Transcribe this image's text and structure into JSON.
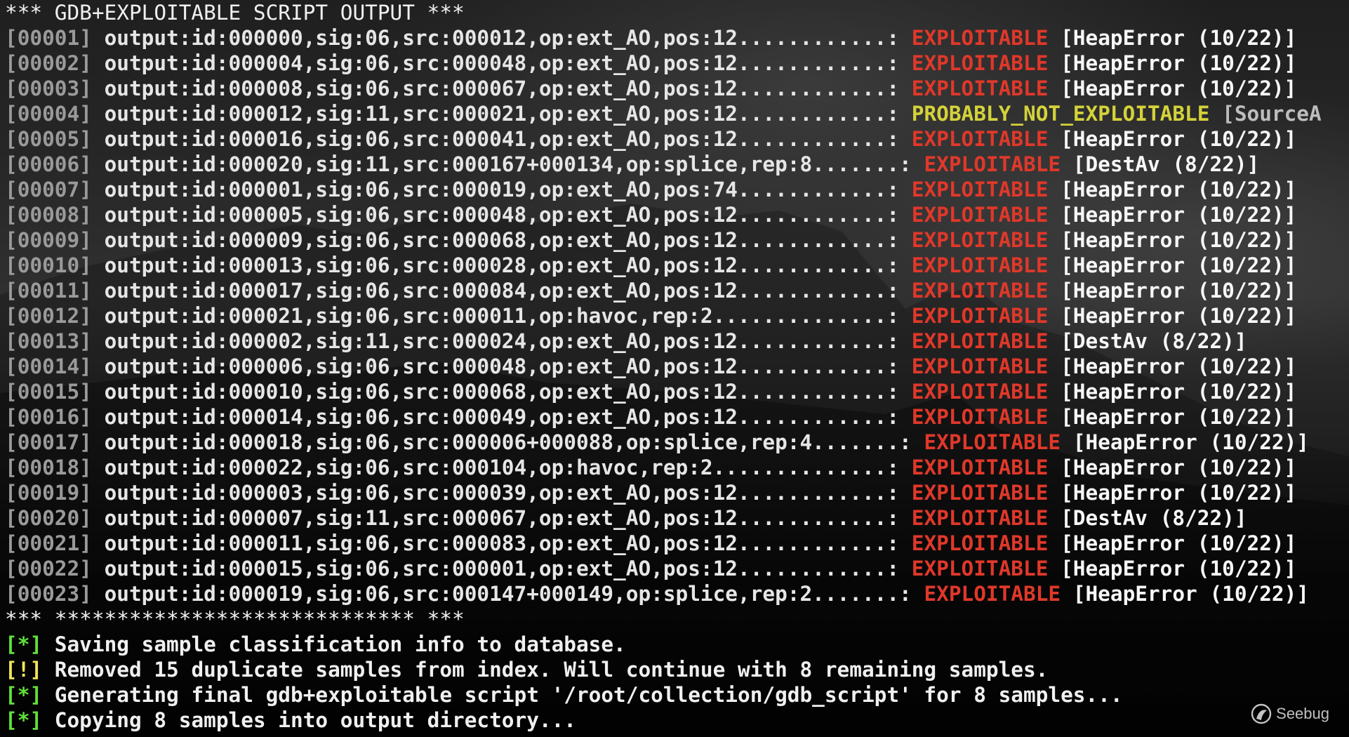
{
  "header": "*** GDB+EXPLOITABLE SCRIPT OUTPUT ***",
  "rows": [
    {
      "idx": "[00001]",
      "path": "output:id:000000,sig:06,src:000012,op:ext_AO,pos:12............:",
      "cls": "EXPLOITABLE",
      "tag": "[HeapError (10/22)]",
      "color": "red"
    },
    {
      "idx": "[00002]",
      "path": "output:id:000004,sig:06,src:000048,op:ext_AO,pos:12............:",
      "cls": "EXPLOITABLE",
      "tag": "[HeapError (10/22)]",
      "color": "red"
    },
    {
      "idx": "[00003]",
      "path": "output:id:000008,sig:06,src:000067,op:ext_AO,pos:12............:",
      "cls": "EXPLOITABLE",
      "tag": "[HeapError (10/22)]",
      "color": "red"
    },
    {
      "idx": "[00004]",
      "path": "output:id:000012,sig:11,src:000021,op:ext_AO,pos:12............:",
      "cls": "PROBABLY_NOT_EXPLOITABLE",
      "tag": "[SourceA",
      "color": "yellow"
    },
    {
      "idx": "[00005]",
      "path": "output:id:000016,sig:06,src:000041,op:ext_AO,pos:12............:",
      "cls": "EXPLOITABLE",
      "tag": "[HeapError (10/22)]",
      "color": "red"
    },
    {
      "idx": "[00006]",
      "path": "output:id:000020,sig:11,src:000167+000134,op:splice,rep:8.......:",
      "cls": "EXPLOITABLE",
      "tag": "[DestAv (8/22)]",
      "color": "red"
    },
    {
      "idx": "[00007]",
      "path": "output:id:000001,sig:06,src:000019,op:ext_AO,pos:74............:",
      "cls": "EXPLOITABLE",
      "tag": "[HeapError (10/22)]",
      "color": "red"
    },
    {
      "idx": "[00008]",
      "path": "output:id:000005,sig:06,src:000048,op:ext_AO,pos:12............:",
      "cls": "EXPLOITABLE",
      "tag": "[HeapError (10/22)]",
      "color": "red"
    },
    {
      "idx": "[00009]",
      "path": "output:id:000009,sig:06,src:000068,op:ext_AO,pos:12............:",
      "cls": "EXPLOITABLE",
      "tag": "[HeapError (10/22)]",
      "color": "red"
    },
    {
      "idx": "[00010]",
      "path": "output:id:000013,sig:06,src:000028,op:ext_AO,pos:12............:",
      "cls": "EXPLOITABLE",
      "tag": "[HeapError (10/22)]",
      "color": "red"
    },
    {
      "idx": "[00011]",
      "path": "output:id:000017,sig:06,src:000084,op:ext_AO,pos:12............:",
      "cls": "EXPLOITABLE",
      "tag": "[HeapError (10/22)]",
      "color": "red"
    },
    {
      "idx": "[00012]",
      "path": "output:id:000021,sig:06,src:000011,op:havoc,rep:2..............:",
      "cls": "EXPLOITABLE",
      "tag": "[HeapError (10/22)]",
      "color": "red"
    },
    {
      "idx": "[00013]",
      "path": "output:id:000002,sig:11,src:000024,op:ext_AO,pos:12............:",
      "cls": "EXPLOITABLE",
      "tag": "[DestAv (8/22)]",
      "color": "red"
    },
    {
      "idx": "[00014]",
      "path": "output:id:000006,sig:06,src:000048,op:ext_AO,pos:12............:",
      "cls": "EXPLOITABLE",
      "tag": "[HeapError (10/22)]",
      "color": "red"
    },
    {
      "idx": "[00015]",
      "path": "output:id:000010,sig:06,src:000068,op:ext_AO,pos:12............:",
      "cls": "EXPLOITABLE",
      "tag": "[HeapError (10/22)]",
      "color": "red"
    },
    {
      "idx": "[00016]",
      "path": "output:id:000014,sig:06,src:000049,op:ext_AO,pos:12............:",
      "cls": "EXPLOITABLE",
      "tag": "[HeapError (10/22)]",
      "color": "red"
    },
    {
      "idx": "[00017]",
      "path": "output:id:000018,sig:06,src:000006+000088,op:splice,rep:4.......:",
      "cls": "EXPLOITABLE",
      "tag": "[HeapError (10/22)]",
      "color": "red"
    },
    {
      "idx": "[00018]",
      "path": "output:id:000022,sig:06,src:000104,op:havoc,rep:2..............:",
      "cls": "EXPLOITABLE",
      "tag": "[HeapError (10/22)]",
      "color": "red"
    },
    {
      "idx": "[00019]",
      "path": "output:id:000003,sig:06,src:000039,op:ext_AO,pos:12............:",
      "cls": "EXPLOITABLE",
      "tag": "[HeapError (10/22)]",
      "color": "red"
    },
    {
      "idx": "[00020]",
      "path": "output:id:000007,sig:11,src:000067,op:ext_AO,pos:12............:",
      "cls": "EXPLOITABLE",
      "tag": "[DestAv (8/22)]",
      "color": "red"
    },
    {
      "idx": "[00021]",
      "path": "output:id:000011,sig:06,src:000083,op:ext_AO,pos:12............:",
      "cls": "EXPLOITABLE",
      "tag": "[HeapError (10/22)]",
      "color": "red"
    },
    {
      "idx": "[00022]",
      "path": "output:id:000015,sig:06,src:000001,op:ext_AO,pos:12............:",
      "cls": "EXPLOITABLE",
      "tag": "[HeapError (10/22)]",
      "color": "red"
    },
    {
      "idx": "[00023]",
      "path": "output:id:000019,sig:06,src:000147+000149,op:splice,rep:2.......:",
      "cls": "EXPLOITABLE",
      "tag": "[HeapError (10/22)]",
      "color": "red"
    }
  ],
  "footer": "*** ***************************** ***",
  "messages": [
    {
      "mark": "[*]",
      "text": "Saving sample classification info to database.",
      "color": "green"
    },
    {
      "mark": "[!]",
      "text": "Removed 15 duplicate samples from index. Will continue with 8 remaining samples.",
      "color": "yellow"
    },
    {
      "mark": "[*]",
      "text": "Generating final gdb+exploitable script '/root/collection/gdb_script' for 8 samples...",
      "color": "green"
    },
    {
      "mark": "[*]",
      "text": "Copying 8 samples into output directory...",
      "color": "green"
    }
  ],
  "watermark": "Seebug",
  "colors": {
    "exploitable": "#e0382a",
    "probably_not": "#d4d23a",
    "mark_green": "#5fe03a",
    "mark_yellow": "#f0e55a"
  }
}
